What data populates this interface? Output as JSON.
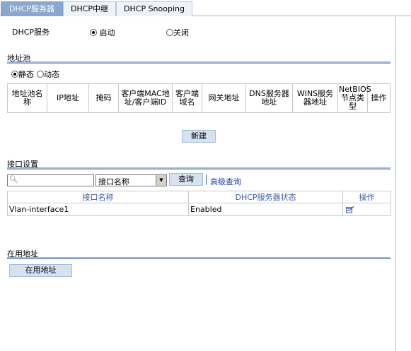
{
  "tabs": [
    {
      "label": "DHCP服务器",
      "active": true
    },
    {
      "label": "DHCP中继",
      "active": false
    },
    {
      "label": "DHCP Snooping",
      "active": false
    }
  ],
  "dhcp_service": {
    "label": "DHCP服务",
    "options": [
      {
        "label": "启动",
        "checked": true
      },
      {
        "label": "关闭",
        "checked": false
      }
    ]
  },
  "address_pool": {
    "title": "地址池",
    "modes": [
      {
        "label": "静态",
        "checked": true
      },
      {
        "label": "动态",
        "checked": false
      }
    ],
    "columns": [
      "地址池名称",
      "IP地址",
      "掩码",
      "客户端MAC地址/客户端ID",
      "客户端域名",
      "网关地址",
      "DNS服务器地址",
      "WINS服务器地址",
      "NetBIOS节点类型",
      "操作"
    ],
    "new_button": "新建"
  },
  "interface_settings": {
    "title": "接口设置",
    "search_value": "",
    "search_field": "接口名称",
    "query_button": "查询",
    "advanced_link": "高级查询",
    "columns": [
      "接口名称",
      "DHCP服务器状态",
      "操作"
    ],
    "rows": [
      {
        "name": "Vlan-interface1",
        "status": "Enabled",
        "action_icon": "edit-icon"
      }
    ]
  },
  "in_use": {
    "title": "在用地址",
    "button": "在用地址"
  },
  "colors": {
    "tab_active": "#8aa7cf",
    "section_line": "#9db5d6",
    "link": "#1a3fa8",
    "button_bg": "#d6e2f2"
  }
}
